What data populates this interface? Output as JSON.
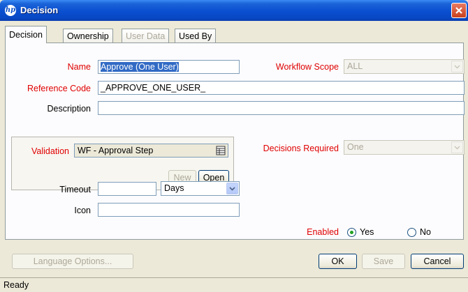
{
  "window": {
    "title": "Decision",
    "logo_text": "hp"
  },
  "tabs": [
    {
      "label": "Decision",
      "state": "active"
    },
    {
      "label": "Ownership",
      "state": "normal"
    },
    {
      "label": "User Data",
      "state": "disabled"
    },
    {
      "label": "Used By",
      "state": "normal"
    }
  ],
  "form": {
    "name_label": "Name",
    "name_value": "Approve (One User)",
    "workflow_scope_label": "Workflow Scope",
    "workflow_scope_value": "ALL",
    "reference_code_label": "Reference Code",
    "reference_code_value": "_APPROVE_ONE_USER_",
    "description_label": "Description",
    "description_value": "",
    "validation_label": "Validation",
    "validation_value": "WF - Approval Step",
    "new_label": "New",
    "open_label": "Open",
    "decisions_required_label": "Decisions Required",
    "decisions_required_value": "One",
    "timeout_label": "Timeout",
    "timeout_value": "",
    "timeout_unit": "Days",
    "icon_label": "Icon",
    "icon_value": "",
    "enabled_label": "Enabled",
    "enabled_yes": "Yes",
    "enabled_no": "No",
    "enabled_selected": "Yes"
  },
  "buttons": {
    "language_options": "Language Options...",
    "ok": "OK",
    "save": "Save",
    "cancel": "Cancel"
  },
  "status": {
    "text": "Ready"
  },
  "colors": {
    "title_bar": "#0a4fd0",
    "required_label": "#e00000",
    "selection": "#316ac5"
  }
}
